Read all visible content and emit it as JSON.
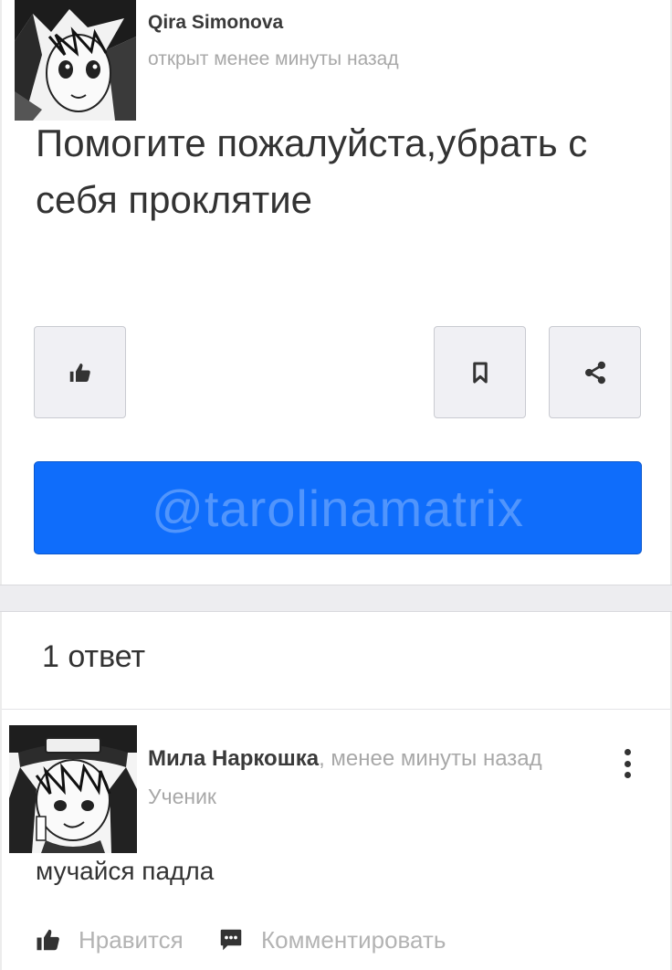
{
  "question": {
    "author": "Qira Simonova",
    "time": "открыт менее минуты назад",
    "text": "Помогите пожалуйста,убрать с себя проклятие",
    "avatar_icon": "manga-avatar",
    "like_icon": "thumbs-up-icon",
    "bookmark_icon": "bookmark-icon",
    "share_icon": "share-icon",
    "answer_button_watermark": "@tarolinamatrix",
    "accent_color": "#0f6dfb"
  },
  "answers": {
    "count_label": "1 ответ",
    "items": [
      {
        "author": "Мила Наркошка",
        "time": ", менее минуты назад",
        "rank": "Ученик",
        "text": "мучайся падла",
        "like_label": "Нравится",
        "comment_label": "Комментировать",
        "avatar_icon": "manga-avatar",
        "more_icon": "more-vertical-icon"
      }
    ]
  }
}
